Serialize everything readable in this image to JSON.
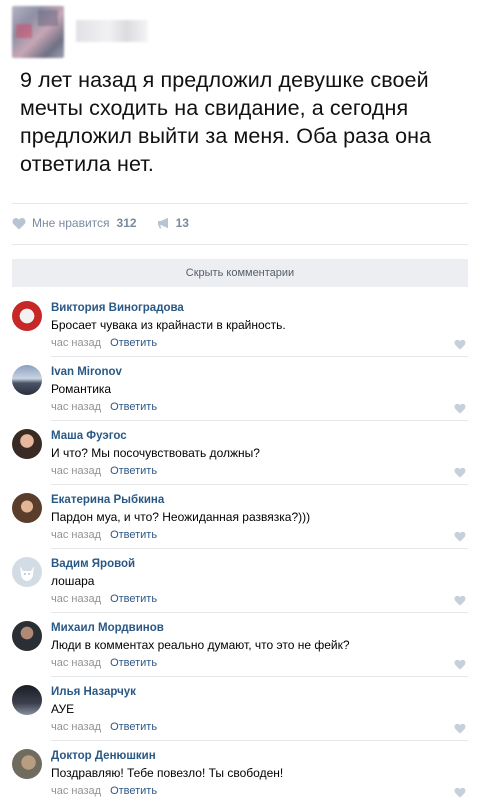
{
  "post": {
    "text": "9 лет назад я предложил девушке своей мечты сходить на свидание, а сегодня предложил выйти за меня. Оба раза она ответила нет.",
    "likes_label": "Мне нравится",
    "likes_count": "312",
    "shares_count": "13"
  },
  "comments_toggle": "Скрыть комментарии",
  "comments": [
    {
      "author": "Виктория Виноградова",
      "text": "Бросает чувака из крайнасти в крайность.",
      "time": "час назад",
      "reply": "Ответить"
    },
    {
      "author": "Ivan Mironov",
      "text": "Романтика",
      "time": "час назад",
      "reply": "Ответить"
    },
    {
      "author": "Маша Фуэгос",
      "text": "И что? Мы посочувствовать должны?",
      "time": "час назад",
      "reply": "Ответить"
    },
    {
      "author": "Екатерина Рыбкина",
      "text": "Пардон муа, и что? Неожиданная развязка?)))",
      "time": "час назад",
      "reply": "Ответить"
    },
    {
      "author": "Вадим Яровой",
      "text": "лошара",
      "time": "час назад",
      "reply": "Ответить"
    },
    {
      "author": "Михаил Мордвинов",
      "text": "Люди в комментах реально думают, что это не фейк?",
      "time": "час назад",
      "reply": "Ответить"
    },
    {
      "author": "Илья Назарчук",
      "text": "АУЕ",
      "time": "час назад",
      "reply": "Ответить"
    },
    {
      "author": "Доктор Денюшкин",
      "text": "Поздравляю! Тебе повезло! Ты свободен!",
      "time": "час назад",
      "reply": "Ответить"
    }
  ],
  "icons": {
    "like": "heart-icon",
    "share": "megaphone-icon"
  },
  "colors": {
    "link": "#2a5885",
    "meta": "#939393",
    "action": "#7a8a9e",
    "bar": "#edeef1"
  }
}
